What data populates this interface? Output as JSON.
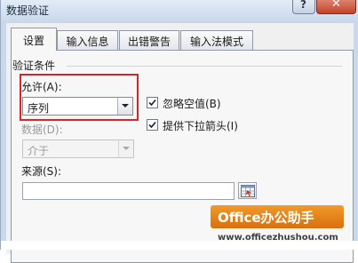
{
  "window": {
    "title": "数据验证",
    "help_label": "?",
    "close_label": "✕"
  },
  "tabs": [
    {
      "label": "设置",
      "active": true
    },
    {
      "label": "输入信息",
      "active": false
    },
    {
      "label": "出错警告",
      "active": false
    },
    {
      "label": "输入法模式",
      "active": false
    }
  ],
  "settings": {
    "section_title": "验证条件",
    "allow": {
      "label": "允许(A):",
      "value": "序列"
    },
    "data": {
      "label": "数据(D):",
      "value": "介于",
      "disabled": true
    },
    "ignore_blank": {
      "label": "忽略空值(B)",
      "checked": true
    },
    "in_cell_dropdown": {
      "label": "提供下拉箭头(I)",
      "checked": true
    },
    "source": {
      "label": "来源(S):",
      "value": ""
    }
  },
  "watermark": {
    "title": "Office办公助手",
    "url": "www.officezhushou.com"
  },
  "colors": {
    "highlight": "#d7262a",
    "watermark_bg": "#f19a2a",
    "title_bar": "#c7d7ea"
  }
}
